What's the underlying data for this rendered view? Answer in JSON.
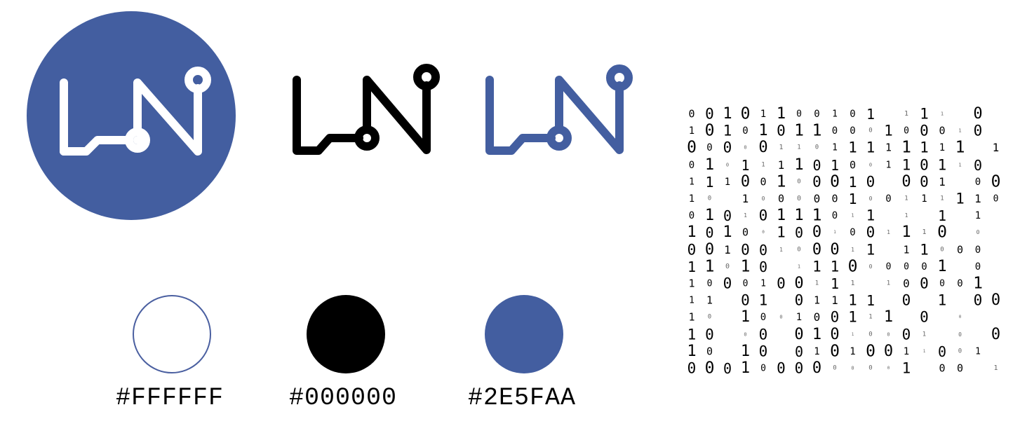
{
  "brand": {
    "primary_color": "#435EA0",
    "mark_white": "#FFFFFF",
    "mark_black": "#000000",
    "logo_icon": "ln-circuit-monogram-icon"
  },
  "swatches": [
    {
      "key": "white",
      "label": "#FFFFFF",
      "fill": "#FFFFFF",
      "outline": "#4A5FA0"
    },
    {
      "key": "black",
      "label": "#000000",
      "fill": "#000000"
    },
    {
      "key": "blue",
      "label": "#2E5FAA",
      "fill": "#435EA0"
    }
  ],
  "binary_pattern": {
    "rows": [
      "00101100101 111 0",
      "10101011000100010",
      "0000011011111111 1",
      "01011110100110110",
      "11100100010 001 00",
      "10 100000100111110",
      "01010111011 1 1 1",
      "101001001001110 0",
      "00100100011 11000 1",
      "11010 111000001 0",
      "1000100111 100001 1",
      "11 01 01111 0 1 00",
      "10 100100111 0 0  1",
      "10 00 01010001 0 0",
      "10 10 01010011001 0",
      "0001000000001 00 11"
    ]
  }
}
